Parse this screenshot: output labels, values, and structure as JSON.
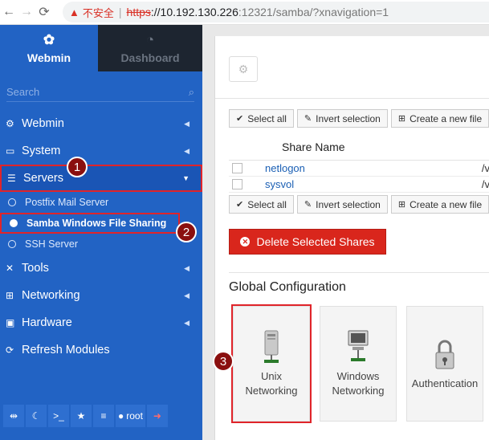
{
  "browser": {
    "warning_label": "不安全",
    "url_scheme": "https",
    "url_host": "://10.192.130.226",
    "url_rest": ":12321/samba/?xnavigation=1"
  },
  "sidebar": {
    "tabs": [
      {
        "label": "Webmin",
        "icon": "webmin-logo-icon"
      },
      {
        "label": "Dashboard",
        "icon": "dashboard-icon"
      }
    ],
    "search_placeholder": "Search",
    "items": [
      {
        "label": "Webmin",
        "icon": "gear-icon"
      },
      {
        "label": "System",
        "icon": "laptop-icon"
      },
      {
        "label": "Servers",
        "icon": "server-icon"
      },
      {
        "label": "Tools",
        "icon": "tools-icon"
      },
      {
        "label": "Networking",
        "icon": "network-icon"
      },
      {
        "label": "Hardware",
        "icon": "hdd-icon"
      },
      {
        "label": "Refresh Modules",
        "icon": "refresh-icon"
      }
    ],
    "subitems": [
      {
        "label": "Postfix Mail Server"
      },
      {
        "label": "Samba Windows File Sharing"
      },
      {
        "label": "SSH Server"
      }
    ],
    "footer_user": "root"
  },
  "annotations": [
    "1",
    "2",
    "3"
  ],
  "toolbar": {
    "select_all": "Select all",
    "invert_selection": "Invert selection",
    "create_new": "Create a new file"
  },
  "table": {
    "header": "Share Name",
    "rows": [
      {
        "name": "netlogon",
        "tail": "/v"
      },
      {
        "name": "sysvol",
        "tail": "/v"
      }
    ]
  },
  "delete_button": "Delete Selected Shares",
  "global_config": {
    "title": "Global Configuration",
    "tiles": [
      {
        "line1": "Unix",
        "line2": "Networking"
      },
      {
        "line1": "Windows",
        "line2": "Networking"
      },
      {
        "line1": "Authentication",
        "line2": ""
      }
    ]
  },
  "colors": {
    "sidebar": "#2263c4",
    "highlight": "#e0242a",
    "delete": "#d9261c"
  }
}
